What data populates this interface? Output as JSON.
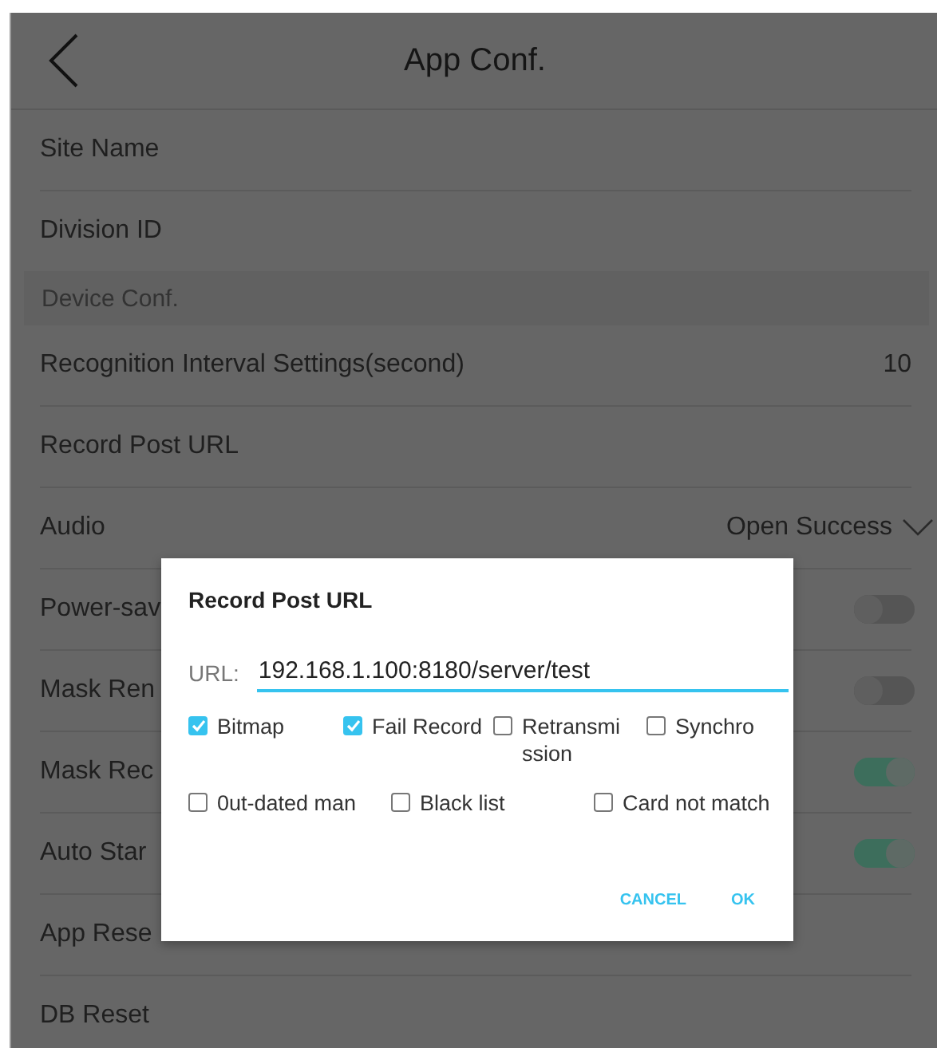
{
  "header": {
    "title": "App Conf."
  },
  "rows": [
    {
      "kind": "plain",
      "label": "Site Name"
    },
    {
      "kind": "plain",
      "label": "Division ID"
    },
    {
      "kind": "section",
      "label": "Device Conf."
    },
    {
      "kind": "value",
      "label": "Recognition Interval Settings(second)",
      "value": "10"
    },
    {
      "kind": "plain",
      "label": "Record Post URL"
    },
    {
      "kind": "dropdown",
      "label": "Audio",
      "value": "Open Success"
    },
    {
      "kind": "switch",
      "label": "Power-sav",
      "on": false
    },
    {
      "kind": "switch",
      "label": "Mask Ren",
      "on": false
    },
    {
      "kind": "switch",
      "label": "Mask Rec",
      "on": true
    },
    {
      "kind": "switch",
      "label": "Auto Star",
      "on": true
    },
    {
      "kind": "plain",
      "label": "App Rese"
    },
    {
      "kind": "plain",
      "label": "DB Reset"
    }
  ],
  "dialog": {
    "title": "Record Post URL",
    "url_label": "URL:",
    "url_value": "192.168.1.100:8180/server/test",
    "options_row_1": [
      {
        "label": "Bitmap",
        "checked": true
      },
      {
        "label": "Fail Record",
        "checked": true
      },
      {
        "label": "Retransmission",
        "checked": false
      },
      {
        "label": "Synchro",
        "checked": false
      }
    ],
    "options_row_2": [
      {
        "label": "0ut-dated man",
        "checked": false
      },
      {
        "label": "Black list",
        "checked": false
      },
      {
        "label": "Card not match",
        "checked": false
      }
    ],
    "buttons": [
      "CANCEL",
      "OK"
    ]
  }
}
